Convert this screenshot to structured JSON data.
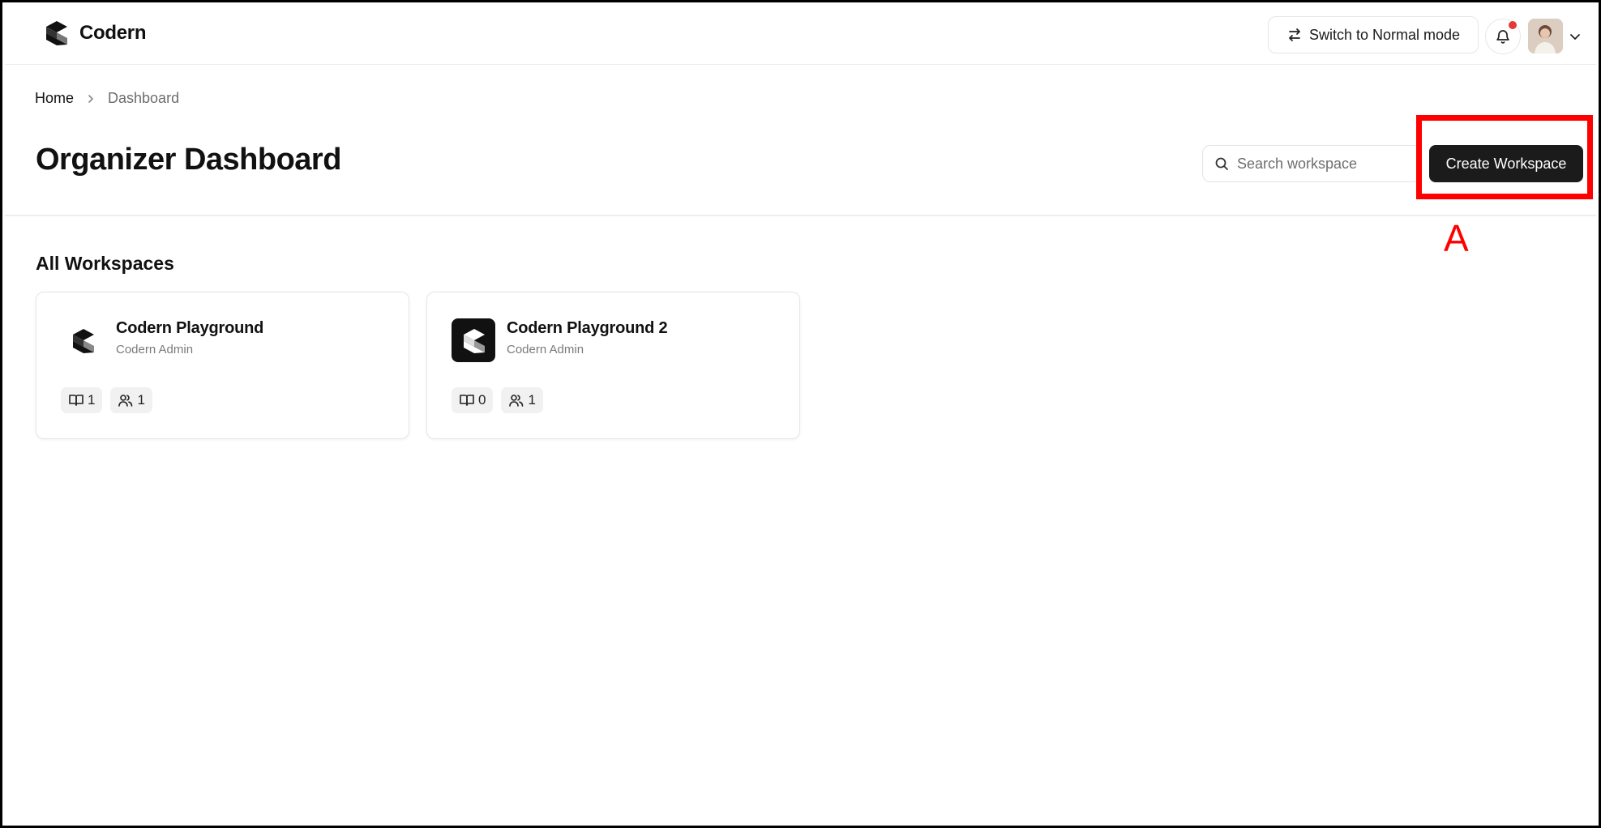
{
  "app": {
    "name": "Codern"
  },
  "topbar": {
    "switch_mode_label": "Switch to Normal mode",
    "notification_dot_color": "#e53935"
  },
  "breadcrumb": {
    "home": "Home",
    "current": "Dashboard"
  },
  "page": {
    "title": "Organizer Dashboard"
  },
  "search": {
    "placeholder": "Search workspace",
    "value": ""
  },
  "actions": {
    "create_label": "Create Workspace"
  },
  "annotation": {
    "label": "A",
    "color": "#ff0000"
  },
  "workspaces": {
    "section_title": "All Workspaces",
    "items": [
      {
        "name": "Codern Playground",
        "owner": "Codern Admin",
        "courses": "1",
        "members": "1",
        "logo_style": "plain"
      },
      {
        "name": "Codern Playground 2",
        "owner": "Codern Admin",
        "courses": "0",
        "members": "1",
        "logo_style": "dark-tile"
      }
    ]
  },
  "icons": {
    "brand": "codern-logo-icon",
    "swap": "swap-arrows-icon",
    "bell": "bell-icon",
    "chevron": "chevron-down-icon",
    "breadcrumb_sep": "chevron-right-icon",
    "search": "search-icon",
    "book": "book-icon",
    "users": "users-icon"
  },
  "colors": {
    "primary_button": "#1b1b1b",
    "muted_text": "#6d6d6d"
  }
}
